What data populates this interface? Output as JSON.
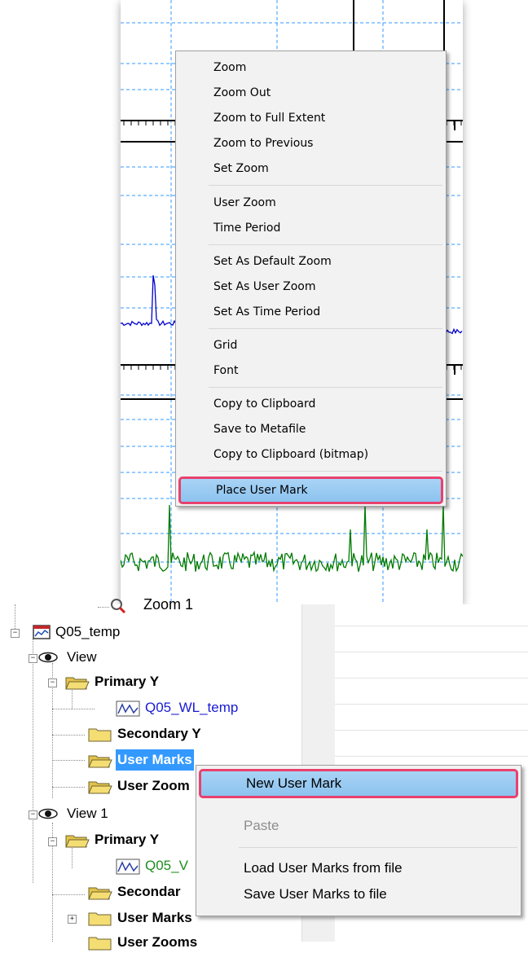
{
  "context_menu_chart": {
    "items": [
      {
        "label": "Zoom"
      },
      {
        "label": "Zoom Out"
      },
      {
        "label": "Zoom to Full Extent"
      },
      {
        "label": "Zoom to Previous"
      },
      {
        "label": "Set Zoom"
      },
      {
        "label": "User Zoom"
      },
      {
        "label": "Time Period"
      },
      {
        "label": "Set As Default Zoom"
      },
      {
        "label": "Set As User Zoom"
      },
      {
        "label": "Set As Time Period"
      },
      {
        "label": "Grid"
      },
      {
        "label": "Font"
      },
      {
        "label": "Copy to Clipboard"
      },
      {
        "label": "Save to Metafile"
      },
      {
        "label": "Copy to Clipboard (bitmap)"
      },
      {
        "label": "Place User Mark"
      }
    ],
    "highlighted": "Place User Mark"
  },
  "tree": {
    "cut_off_top": "Zoom 1",
    "nodes": {
      "q05_temp": "Q05_temp",
      "view": "View",
      "primary_y": "Primary Y",
      "q05_wl_temp": "Q05_WL_temp",
      "secondary_y": "Secondary Y",
      "user_marks": "User Marks",
      "user_zooms": "User Zoom",
      "view1": "View 1",
      "primary_y_2": "Primary Y",
      "q05_v": "Q05_V",
      "secondary_2": "Secondar",
      "user_marks_2": "User Marks",
      "user_zooms_2": "User Zooms"
    },
    "selected": "User Marks"
  },
  "context_menu_tree": {
    "items": [
      {
        "label": "New User Mark",
        "enabled": true
      },
      {
        "label": "Paste",
        "enabled": false
      },
      {
        "label": "Load User Marks from file",
        "enabled": true
      },
      {
        "label": "Save User Marks to file",
        "enabled": true
      }
    ],
    "highlighted": "New User Mark"
  },
  "colors": {
    "series_blue": "#0000cc",
    "series_green": "#007a00",
    "grid": "#3399ff",
    "highlight_border": "#e8416e",
    "highlight_fill": "#99cbf3"
  }
}
